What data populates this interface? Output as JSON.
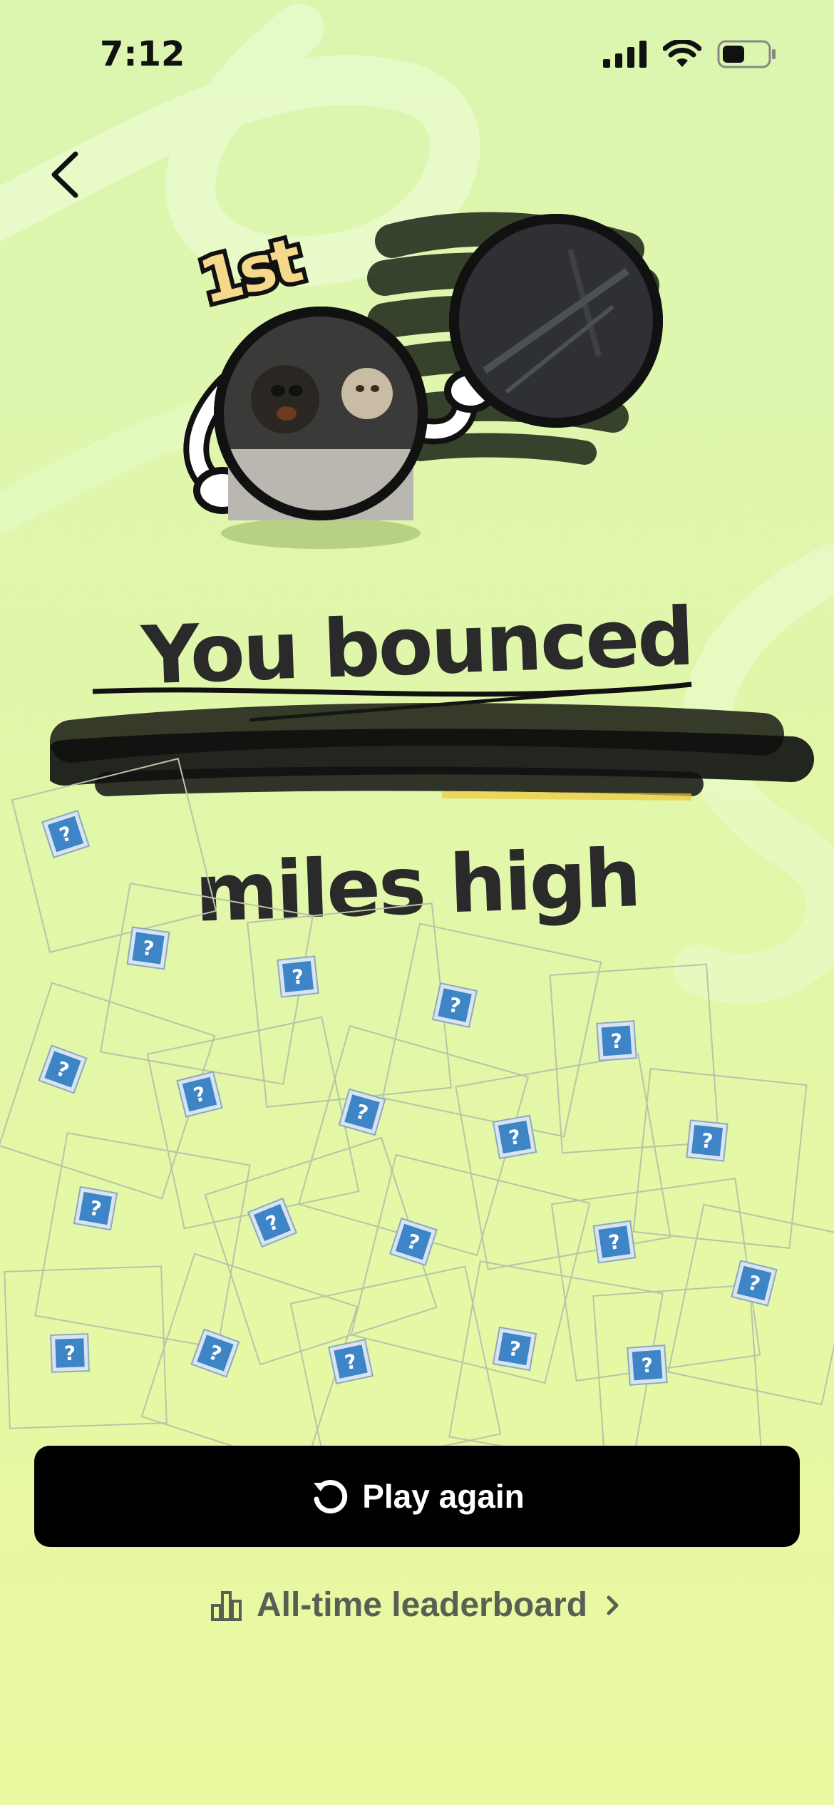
{
  "status_bar": {
    "time": "7:12",
    "icons": [
      "cellular-signal-icon",
      "wifi-icon",
      "battery-icon"
    ]
  },
  "nav": {
    "back_icon": "chevron-left-icon"
  },
  "hero": {
    "rank_badge": "1st"
  },
  "result": {
    "line1": "You bounced",
    "line2_redacted": "",
    "line3": "miles high"
  },
  "actions": {
    "play_again_label": "Play again",
    "play_again_icon": "restart-icon",
    "leaderboard_label": "All-time leaderboard",
    "leaderboard_icon": "bar-chart-icon",
    "leaderboard_chevron_icon": "chevron-right-icon"
  },
  "colors": {
    "background_top": "#dcf6b0",
    "background_bottom": "#ebf9a0",
    "badge_fill": "#f6d88a",
    "button_bg": "#000000",
    "link_text": "#5a5f54",
    "broken_image_blue": "#3d85c6"
  }
}
